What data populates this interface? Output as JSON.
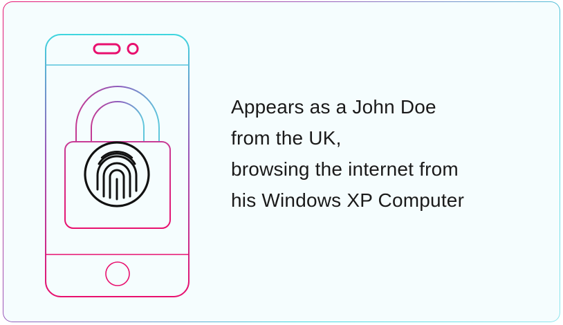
{
  "caption": {
    "lines": [
      "Appears as a John Doe",
      "from the UK,",
      "browsing the internet from",
      "his Windows XP Computer"
    ]
  },
  "colors": {
    "accent_pink": "#e8106e",
    "accent_cyan": "#3fd6df",
    "accent_purple": "#9a55b8",
    "card_background": "#f5fdfe",
    "text": "#1a1a1a"
  },
  "icons": [
    "phone-icon",
    "padlock-icon",
    "fingerprint-icon"
  ]
}
